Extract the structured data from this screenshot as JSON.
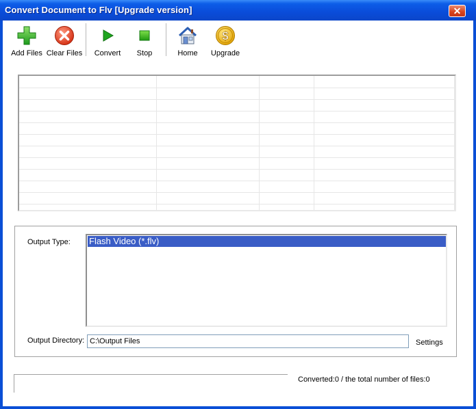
{
  "window": {
    "title": "Convert Document to Flv [Upgrade version]",
    "close_glyph": "✕"
  },
  "toolbar": {
    "items": [
      {
        "label": "Add Files",
        "icon": "plus-icon"
      },
      {
        "label": "Clear Files",
        "icon": "clear-icon"
      },
      {
        "label": "Convert",
        "icon": "play-icon"
      },
      {
        "label": "Stop",
        "icon": "stop-icon"
      },
      {
        "label": "Home",
        "icon": "home-icon"
      },
      {
        "label": "Upgrade",
        "icon": "dollar-icon"
      }
    ]
  },
  "file_list": {
    "rows": []
  },
  "output": {
    "type_label": "Output Type:",
    "types": [
      "Flash Video (*.flv)"
    ],
    "selected_type": "Flash Video (*.flv)",
    "directory_label": "Output Directory:",
    "directory_value": "C:\\Output Files",
    "settings_label": "Settings"
  },
  "status": {
    "converted_label": "Converted:",
    "converted_count": "0",
    "separator": "/",
    "total_label": "the total number of files:",
    "total_count": "0"
  },
  "colors": {
    "titlebar": "#0a4cd9",
    "selection": "#3a5dc6",
    "add_green": "#2fb52f",
    "clear_red": "#e03a1a",
    "play_green": "#1fa51f",
    "upgrade_gold": "#f0b400"
  }
}
